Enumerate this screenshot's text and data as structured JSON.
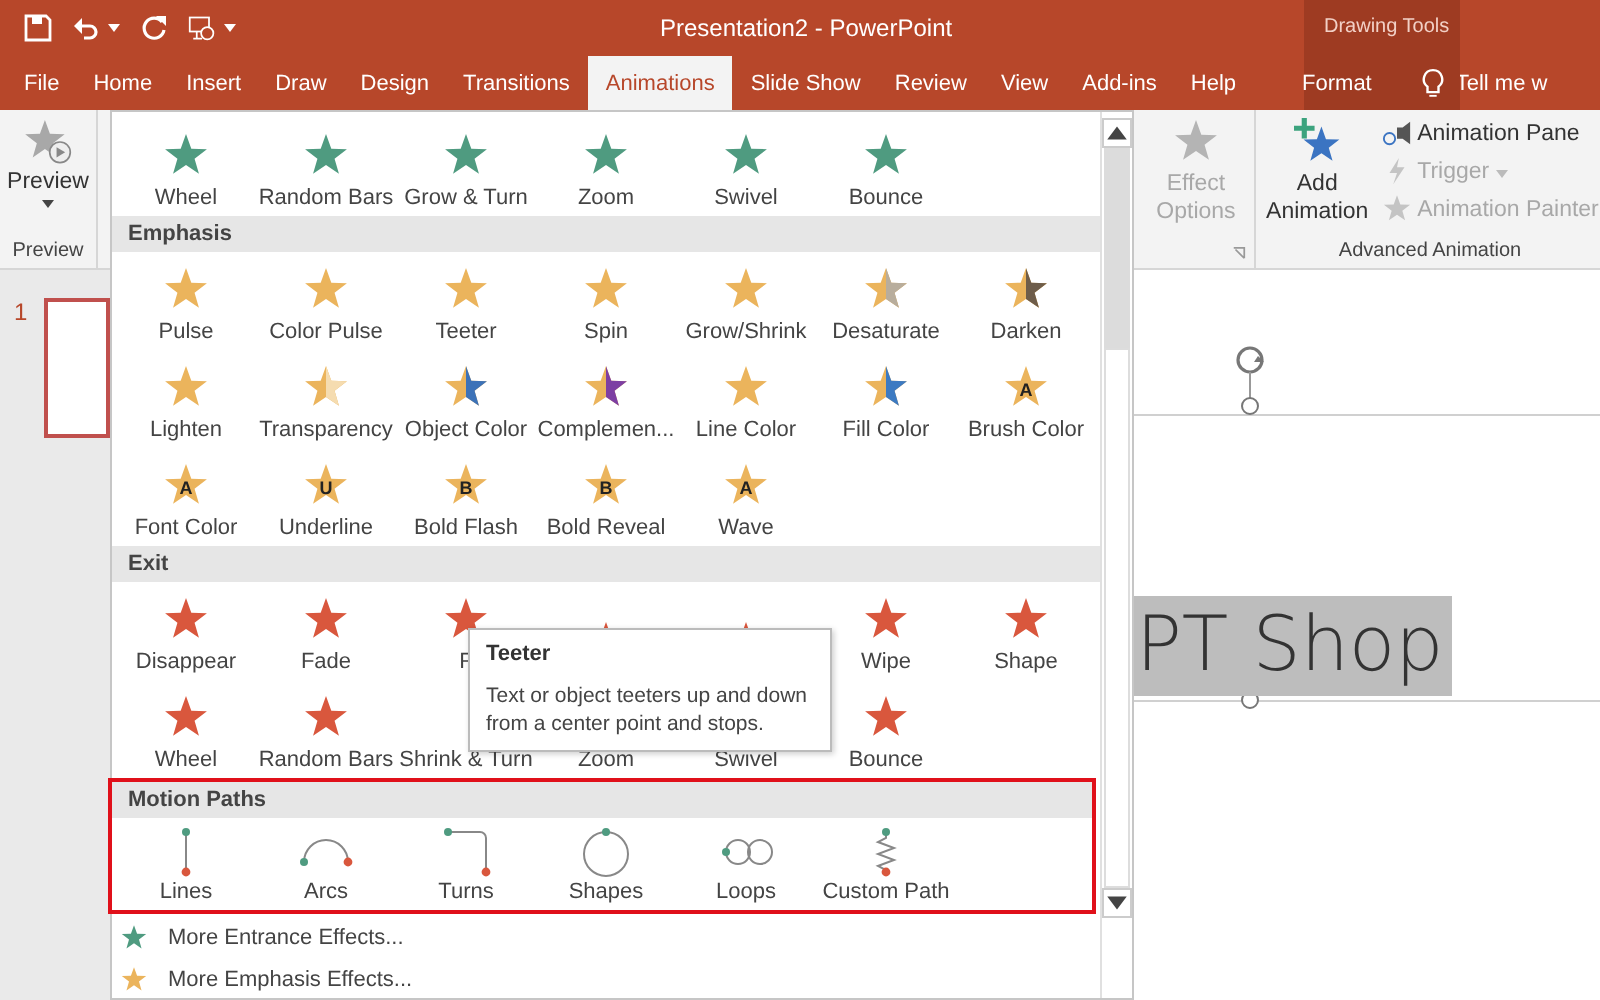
{
  "window": {
    "title": "Presentation2  -  PowerPoint",
    "context_label": "Drawing Tools"
  },
  "tabs": [
    {
      "label": "File",
      "selected": false,
      "contextual": false
    },
    {
      "label": "Home",
      "selected": false,
      "contextual": false
    },
    {
      "label": "Insert",
      "selected": false,
      "contextual": false
    },
    {
      "label": "Draw",
      "selected": false,
      "contextual": false
    },
    {
      "label": "Design",
      "selected": false,
      "contextual": false
    },
    {
      "label": "Transitions",
      "selected": false,
      "contextual": false
    },
    {
      "label": "Animations",
      "selected": true,
      "contextual": false
    },
    {
      "label": "Slide Show",
      "selected": false,
      "contextual": false
    },
    {
      "label": "Review",
      "selected": false,
      "contextual": false
    },
    {
      "label": "View",
      "selected": false,
      "contextual": false
    },
    {
      "label": "Add-ins",
      "selected": false,
      "contextual": false
    },
    {
      "label": "Help",
      "selected": false,
      "contextual": false
    },
    {
      "label": "Format",
      "selected": false,
      "contextual": true
    }
  ],
  "tell_me": "Tell me w",
  "ribbon": {
    "preview": {
      "label": "Preview",
      "group": "Preview"
    },
    "effect_options": {
      "label": "Effect Options",
      "disabled": true
    },
    "advanced": {
      "group": "Advanced Animation",
      "add_label": "Add Animation",
      "items": [
        {
          "label": "Animation Pane",
          "kind": "pane",
          "disabled": false,
          "caret": false
        },
        {
          "label": "Trigger",
          "kind": "trigger",
          "disabled": true,
          "caret": true
        },
        {
          "label": "Animation Painter",
          "kind": "painter",
          "disabled": true,
          "caret": false
        }
      ]
    }
  },
  "slides": [
    {
      "number": "1",
      "selected": true
    }
  ],
  "slide": {
    "text": "PT Shop",
    "selected": true
  },
  "gallery": {
    "sections": [
      {
        "kind": "entrance",
        "items": [
          {
            "label": "Wheel"
          },
          {
            "label": "Random Bars"
          },
          {
            "label": "Grow & Turn"
          },
          {
            "label": "Zoom"
          },
          {
            "label": "Swivel"
          },
          {
            "label": "Bounce"
          }
        ]
      },
      {
        "kind": "emphasis",
        "title": "Emphasis",
        "items": [
          {
            "label": "Pulse"
          },
          {
            "label": "Color Pulse"
          },
          {
            "label": "Teeter"
          },
          {
            "label": "Spin"
          },
          {
            "label": "Grow/Shrink"
          },
          {
            "label": "Desaturate",
            "color": "#b8ad9c"
          },
          {
            "label": "Darken",
            "color": "#6e5d4a"
          },
          {
            "label": "Lighten"
          },
          {
            "label": "Transparency",
            "color": "#f5dcb0"
          },
          {
            "label": "Object Color",
            "color": "#3c72b8"
          },
          {
            "label": "Complemen...",
            "color": "#7d3fa3"
          },
          {
            "label": "Line Color"
          },
          {
            "label": "Fill Color",
            "color": "#3c7ac2"
          },
          {
            "label": "Brush Color",
            "glyph": "A"
          },
          {
            "label": "Font Color",
            "glyph": "A"
          },
          {
            "label": "Underline",
            "glyph": "U"
          },
          {
            "label": "Bold Flash",
            "glyph": "B"
          },
          {
            "label": "Bold Reveal",
            "glyph": "B"
          },
          {
            "label": "Wave",
            "glyph": "A"
          }
        ]
      },
      {
        "kind": "exit",
        "title": "Exit",
        "items": [
          {
            "label": "Disappear",
            "kind": "star"
          },
          {
            "label": "Fade",
            "kind": "star"
          },
          {
            "label": "F",
            "kind": "star"
          },
          {
            "kind": "star"
          },
          {
            "kind": "star"
          },
          {
            "label": "Wipe",
            "kind": "star"
          },
          {
            "label": "Shape",
            "kind": "star"
          },
          {
            "label": "Wheel",
            "kind": "star"
          },
          {
            "label": "Random Bars",
            "kind": "star"
          },
          {
            "label": "Shrink & Turn",
            "kind": "label"
          },
          {
            "label": "Zoom",
            "kind": "label"
          },
          {
            "label": "Swivel",
            "kind": "label"
          },
          {
            "label": "Bounce",
            "kind": "star"
          }
        ]
      },
      {
        "kind": "motion",
        "title": "Motion Paths",
        "highlighted": true,
        "items": [
          {
            "label": "Lines",
            "kind": "line"
          },
          {
            "label": "Arcs",
            "kind": "arc"
          },
          {
            "label": "Turns",
            "kind": "turn"
          },
          {
            "label": "Shapes",
            "kind": "shape"
          },
          {
            "label": "Loops",
            "kind": "loop"
          },
          {
            "label": "Custom Path",
            "kind": "custom"
          }
        ]
      }
    ],
    "links": [
      {
        "label": "More Entrance Effects...",
        "kind": "entrance"
      },
      {
        "label": "More Emphasis Effects...",
        "kind": "emphasis"
      }
    ]
  },
  "tooltip": {
    "title": "Teeter",
    "text": "Text or object teeters up and down from a center point and stops."
  }
}
